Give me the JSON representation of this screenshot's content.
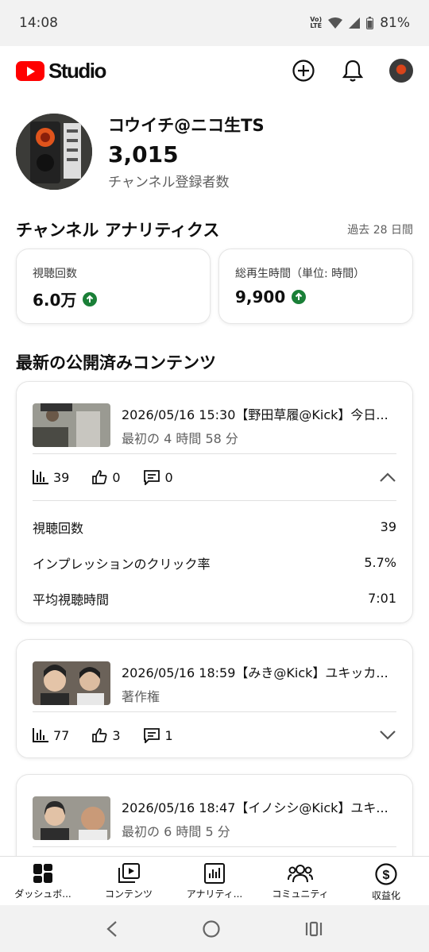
{
  "status": {
    "time": "14:08",
    "lte": "Vo) LTE",
    "battery": "81%"
  },
  "app": {
    "logo": "Studio"
  },
  "channel": {
    "name": "コウイチ@ニコ生TS",
    "subscribers": "3,015",
    "subscribers_label": "チャンネル登録者数"
  },
  "analytics": {
    "title": "チャンネル アナリティクス",
    "period": "過去 28 日間",
    "cards": [
      {
        "label": "視聴回数",
        "value": "6.0万",
        "trend": "up"
      },
      {
        "label": "総再生時間（単位: 時間）",
        "value": "9,900",
        "trend": "up"
      }
    ]
  },
  "latest": {
    "title": "最新の公開済みコンテンツ",
    "videos": [
      {
        "title": "2026/05/16 15:30【野田草履@Kick】今日...",
        "subtitle": "最初の 4 時間 58 分",
        "views": "39",
        "likes": "0",
        "comments": "0",
        "expanded": true,
        "details": [
          {
            "label": "視聴回数",
            "value": "39"
          },
          {
            "label": "インプレッションのクリック率",
            "value": "5.7%"
          },
          {
            "label": "平均視聴時間",
            "value": "7:01"
          }
        ]
      },
      {
        "title": "2026/05/16 18:59【みき@Kick】ユキッカ...",
        "subtitle": "著作権",
        "views": "77",
        "likes": "3",
        "comments": "1",
        "expanded": false
      },
      {
        "title": "2026/05/16 18:47【イノシシ@Kick】ユキ...",
        "subtitle": "最初の 6 時間 5 分",
        "expanded": false
      }
    ]
  },
  "nav": {
    "items": [
      {
        "label": "ダッシュボ...",
        "icon": "dashboard-icon"
      },
      {
        "label": "コンテンツ",
        "icon": "content-icon"
      },
      {
        "label": "アナリティ...",
        "icon": "analytics-icon"
      },
      {
        "label": "コミュニティ",
        "icon": "community-icon"
      },
      {
        "label": "収益化",
        "icon": "monetization-icon"
      }
    ]
  },
  "colors": {
    "brand_red": "#ff0000",
    "trend_green": "#1a7f37"
  }
}
